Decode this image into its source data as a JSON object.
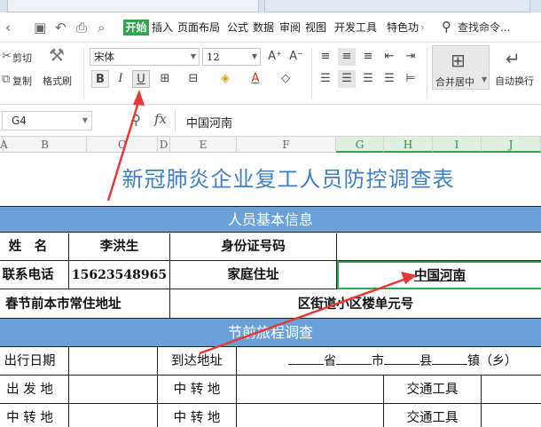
{
  "menu": {
    "start_tab": "开始",
    "tabs": [
      "插入",
      "页面布局",
      "公式",
      "数据",
      "审阅",
      "视图",
      "开发工具",
      "特色功"
    ],
    "search": "查找命令..."
  },
  "ribbon": {
    "cut": "剪切",
    "copy": "复制",
    "format_painter": "格式刷",
    "font_name": "宋体",
    "font_size": "12",
    "merge_center": "合并居中",
    "auto_wrap": "自动换行"
  },
  "formula_bar": {
    "name_box": "G4",
    "fx": "fx",
    "content": "中国河南"
  },
  "columns": [
    "A",
    "B",
    "C",
    "D",
    "E",
    "F",
    "G",
    "H",
    "I",
    "J"
  ],
  "sheet": {
    "title": "新冠肺炎企业复工人员防控调查表",
    "section1": "人员基本信息",
    "name_label": "姓　名",
    "name_value": "李洪生",
    "id_label": "身份证号码",
    "phone_label": "联系电话",
    "phone_value": "15623548965",
    "home_label": "家庭住址",
    "home_value": "中国河南",
    "pre_address_label": "春节前本市常住地址",
    "pre_address_value": "区街道小区楼单元号",
    "section2": "节前旅程调查",
    "travel_date": "出行日期",
    "arrival": "到达地址",
    "arrival_fill": [
      "省",
      "市",
      "县",
      "镇（乡）"
    ],
    "departure": "出 发 地",
    "transfer": "中 转 地",
    "transport": "交通工具"
  },
  "colors": {
    "accent_green": "#2fa64b",
    "band_blue": "#6aa1d9",
    "title_blue": "#3d7fc1",
    "arrow_red": "#e53935"
  }
}
